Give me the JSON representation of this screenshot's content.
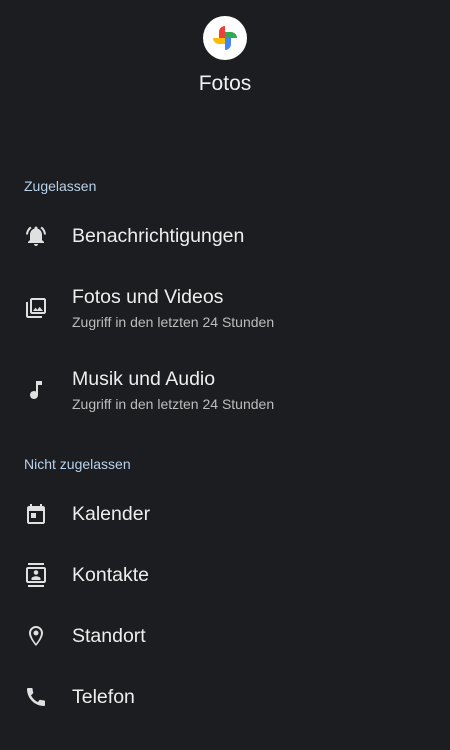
{
  "app": {
    "name": "Fotos",
    "icon": "google-photos-pinwheel-icon"
  },
  "colors": {
    "background": "#1b1d20",
    "section_header": "#b9d2ea",
    "primary_text": "#eeeeee",
    "secondary_text": "#bdbdbd",
    "logo_red": "#ea4335",
    "logo_yellow": "#fbbc04",
    "logo_green": "#34a853",
    "logo_blue": "#4285f4"
  },
  "sections": {
    "allowed": {
      "header": "Zugelassen",
      "items": [
        {
          "title": "Benachrichtigungen",
          "icon": "bell-icon"
        },
        {
          "title": "Fotos und Videos",
          "subtitle": "Zugriff in den letzten 24 Stunden",
          "icon": "photo-library-icon"
        },
        {
          "title": "Musik und Audio",
          "subtitle": "Zugriff in den letzten 24 Stunden",
          "icon": "music-note-icon"
        }
      ]
    },
    "not_allowed": {
      "header": "Nicht zugelassen",
      "items": [
        {
          "title": "Kalender",
          "icon": "calendar-icon"
        },
        {
          "title": "Kontakte",
          "icon": "contacts-icon"
        },
        {
          "title": "Standort",
          "icon": "location-icon"
        },
        {
          "title": "Telefon",
          "icon": "phone-icon"
        }
      ]
    }
  }
}
